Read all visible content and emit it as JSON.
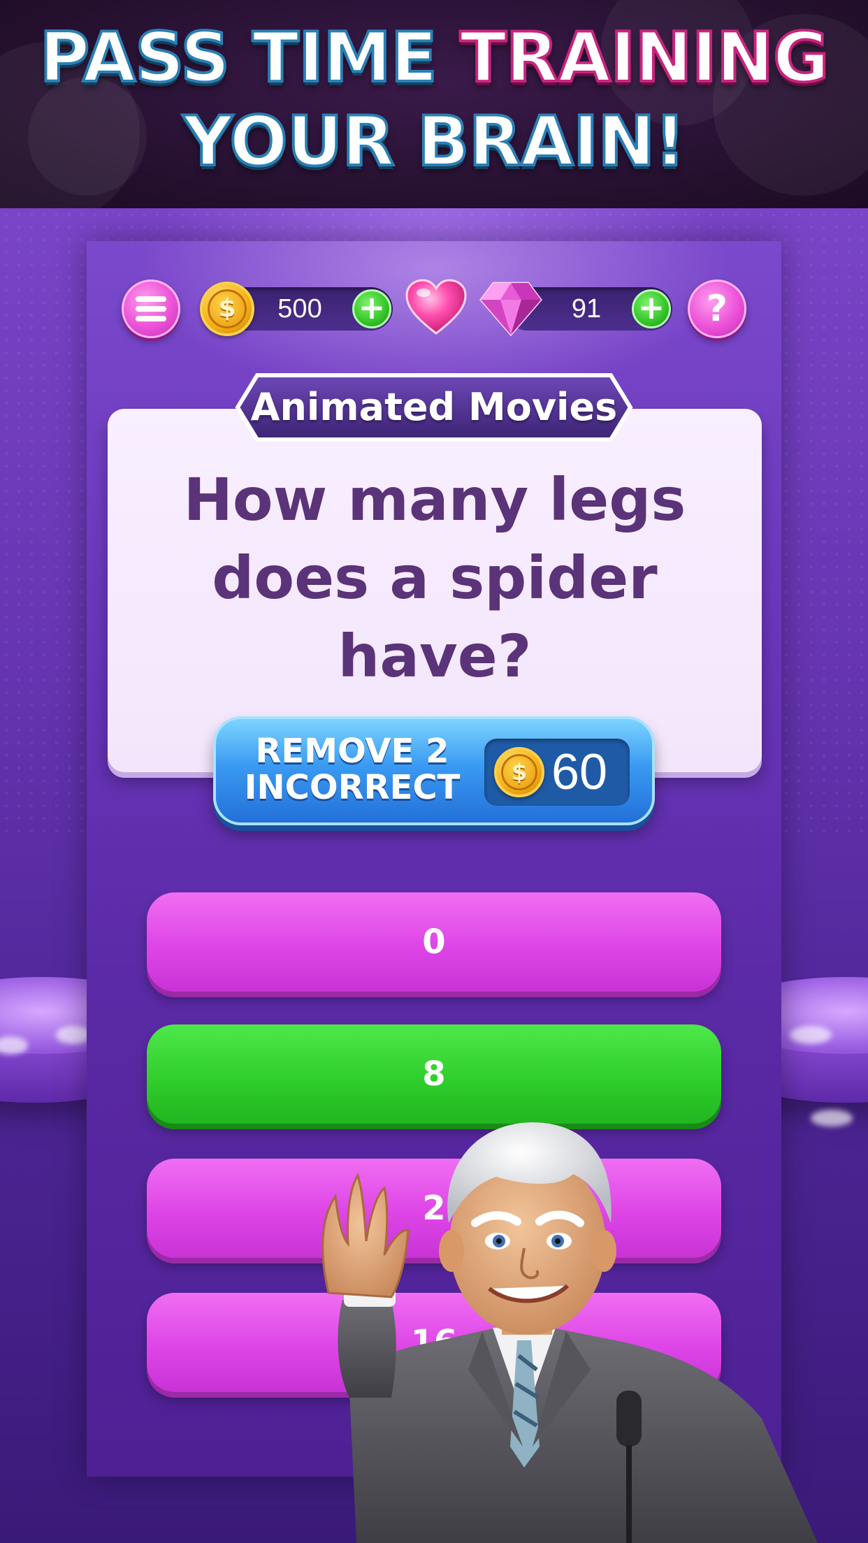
{
  "banner": {
    "line1_part1": "PASS TIME ",
    "line1_part2": "TRAINING",
    "line2": "YOUR BRAIN!"
  },
  "top_bar": {
    "menu_icon": "menu-icon",
    "coins": "500",
    "coins_icon": "coin-icon",
    "coin_symbol": "$",
    "add_coins_label": "+",
    "lives_icon": "heart-icon",
    "gems_icon": "gem-icon",
    "gems": "91",
    "add_gems_label": "+",
    "help_label": "?"
  },
  "question": {
    "category": "Animated Movies",
    "text": "How many legs does a spider have?"
  },
  "lifeline": {
    "label": "REMOVE 2 INCORRECT",
    "cost": "60",
    "coin_symbol": "$"
  },
  "answers": [
    {
      "label": "0",
      "state": "default"
    },
    {
      "label": "8",
      "state": "correct"
    },
    {
      "label": "2",
      "state": "default"
    },
    {
      "label": "16",
      "state": "default"
    }
  ],
  "colors": {
    "answer_default": "#e04ae8",
    "answer_correct": "#2fcf2c",
    "lifeline_blue": "#3a9af2",
    "question_text": "#5b3379",
    "panel_purple": "#6a37bb"
  }
}
